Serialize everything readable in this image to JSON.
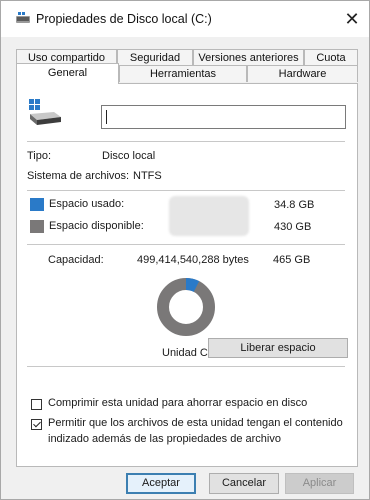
{
  "window": {
    "title": "Propiedades de Disco local (C:)",
    "close_glyph": "✕"
  },
  "tabs": {
    "row1": [
      "Uso compartido",
      "Seguridad",
      "Versiones anteriores",
      "Cuota"
    ],
    "row2": [
      "General",
      "Herramientas",
      "Hardware"
    ],
    "active": "General"
  },
  "general": {
    "drive_name_value": "",
    "type_label": "Tipo:",
    "type_value": "Disco local",
    "fs_label": "Sistema de archivos:",
    "fs_value": "NTFS",
    "used_label": "Espacio usado:",
    "used_size": "34.8 GB",
    "free_label": "Espacio disponible:",
    "free_size": "430 GB",
    "capacity_label": "Capacidad:",
    "capacity_bytes": "499,414,540,288 bytes",
    "capacity_size": "465 GB",
    "drive_label": "Unidad C",
    "cleanup_button": "Liberar espacio",
    "compress_label": "Comprimir esta unidad para ahorrar espacio en disco",
    "compress_checked": false,
    "index_label_line1": "Permitir que los archivos de esta unidad tengan el contenido",
    "index_label_line2": "indizado además de las propiedades de archivo",
    "index_checked": true,
    "used_fraction": 0.075
  },
  "colors": {
    "used": "#2a7ac8",
    "free": "#7a7878",
    "primary_border": "#3c7fb1"
  },
  "buttons": {
    "ok": "Aceptar",
    "cancel": "Cancelar",
    "apply": "Aplicar"
  }
}
